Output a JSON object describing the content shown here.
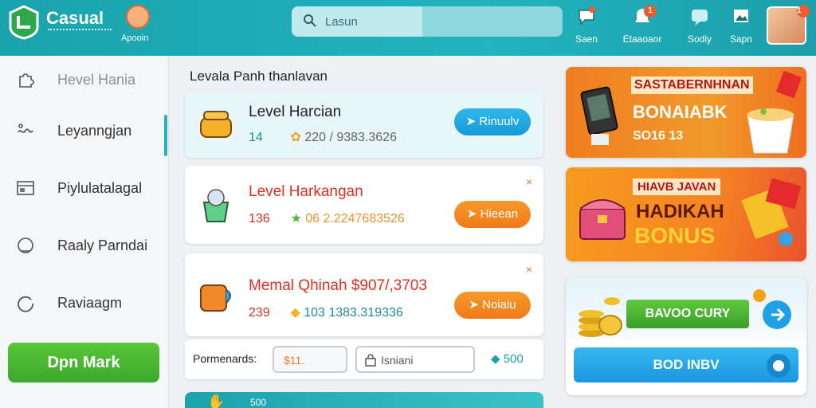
{
  "header": {
    "brand": "Casual",
    "avatar_label": "Apooin",
    "search_placeholder": "Lasun",
    "nav": [
      {
        "label": "Saen",
        "icon": "chat-icon",
        "badge": ""
      },
      {
        "label": "Etaaoaor",
        "icon": "bell-icon",
        "badge": "1"
      },
      {
        "label": "Sodiy",
        "icon": "message-icon",
        "badge": ""
      },
      {
        "label": "Sapn",
        "icon": "image-icon",
        "badge": ""
      }
    ],
    "profile_badge": "1"
  },
  "sidebar": {
    "items": [
      {
        "label": "Hevel Hania",
        "icon": "puzzle-icon"
      },
      {
        "label": "Leyanngjan",
        "icon": "wave-icon"
      },
      {
        "label": "Piylulatalagal",
        "icon": "calendar-icon"
      },
      {
        "label": "Raaly Parndai",
        "icon": "globe-icon"
      },
      {
        "label": "Raviaagm",
        "icon": "refresh-icon"
      }
    ],
    "cta": "Dpn Mark"
  },
  "main": {
    "title": "Levala Panh thanlavan",
    "cards": [
      {
        "title": "Level Harcian",
        "stat_a": "14",
        "stat_b": "220 / 9383.3626",
        "button": "Rinuulv",
        "button_icon": "arrow-icon",
        "close": ""
      },
      {
        "title": "Level Harkangan",
        "stat_a": "136",
        "stat_b": "06   2.2247683526",
        "button": "Hieean",
        "button_icon": "arrow-icon",
        "close": "×"
      },
      {
        "title": "Memal Qhinah $907/,3703",
        "stat_a": "239",
        "stat_b": "103  1383.319336",
        "button": "Noiaiu",
        "button_icon": "arrow-icon",
        "close": "×"
      }
    ],
    "filter": {
      "label": "Pormenards:",
      "value_a": "$11.",
      "search_placeholder": "Isniani",
      "value_c": "500"
    },
    "bottom_text": "500"
  },
  "promos": {
    "one": {
      "line1": "SASTABERNHNAN",
      "line2": "BONAIABK",
      "line3": "SO16 13"
    },
    "two": {
      "line1": "HIAVB JAVAN",
      "line2": "HADIKAH",
      "line3": "BONUS"
    },
    "three": {
      "green_button": "BAVOO CURY",
      "blue_button": "BOD INBV"
    }
  },
  "colors": {
    "teal": "#1aa3ad",
    "green": "#4ab533",
    "orange": "#f58423",
    "blue": "#1e9fe6"
  }
}
